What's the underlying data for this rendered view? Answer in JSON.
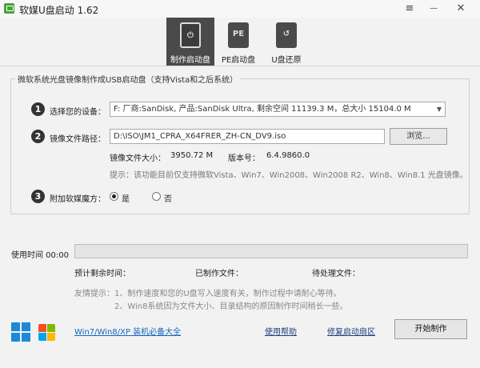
{
  "window": {
    "title": "软媒U盘启动 1.62",
    "menu_glyph": "≡",
    "minimize_glyph": "—",
    "close_glyph": "✕"
  },
  "tabs": [
    {
      "label": "制作启动盘",
      "icon": "usb-power-icon",
      "glyph": "⏻",
      "active": true
    },
    {
      "label": "PE启动盘",
      "icon": "usb-pe-icon",
      "glyph": "PE",
      "active": false
    },
    {
      "label": "U盘还原",
      "icon": "usb-restore-icon",
      "glyph": "↺",
      "active": false
    }
  ],
  "section": {
    "title": "微软系统光盘镜像制作成USB启动盘（支持Vista和之后系统）"
  },
  "step1": {
    "num": "1",
    "label": "选择您的设备：",
    "device": "F: 厂商:SanDisk, 产品:SanDisk Ultra, 剩余空间 11139.3 M，总大小 15104.0 M"
  },
  "step2": {
    "num": "2",
    "label": "镜像文件路径：",
    "path": "D:\\ISO\\JM1_CPRA_X64FRER_ZH-CN_DV9.iso",
    "browse": "浏览...",
    "size_label": "镜像文件大小：",
    "size_value": "3950.72 M",
    "version_label": "版本号：",
    "version_value": "6.4.9860.0",
    "tip": "提示：该功能目前仅支持微软Vista、Win7、Win2008、Win2008 R2、Win8、Win8.1 光盘镜像。"
  },
  "step3": {
    "num": "3",
    "label": "附加软媒魔方：",
    "yes": "是",
    "no": "否",
    "selected": "是"
  },
  "progress": {
    "label": "使用时间 00:00",
    "value": 0
  },
  "stats": {
    "remaining": "预计剩余时间：",
    "made": "已制作文件：",
    "pending": "待处理文件："
  },
  "hints": {
    "line1": "友情提示：1、制作速度和您的U盘写入速度有关，制作过程中请耐心等待。",
    "line2": "2、Win8系统因为文件大小、目录结构的原因制作时间稍长一些。"
  },
  "footer": {
    "win_link": "Win7/Win8/XP 装机必备大全",
    "help": "使用帮助",
    "repair": "修复启动扇区",
    "start": "开始制作"
  },
  "colors": {
    "accent": "#4a4a4a",
    "win8": "#1e88d8",
    "link": "#1565c0"
  }
}
